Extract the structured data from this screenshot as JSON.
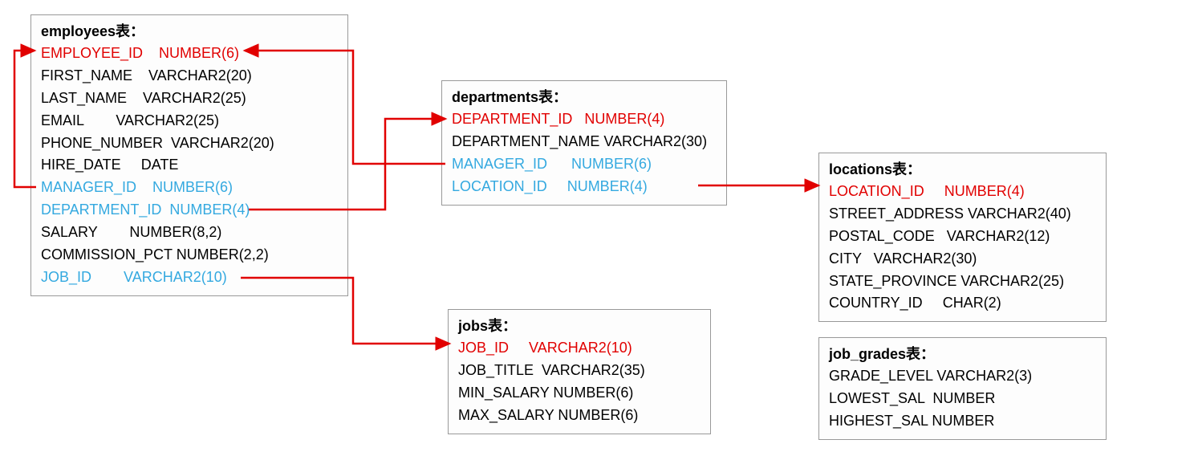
{
  "tables": {
    "employees": {
      "title": "employees表：",
      "cols": [
        {
          "n": "EMPLOYEE_ID",
          "t": "NUMBER(6)",
          "role": "pk",
          "pad": 4
        },
        {
          "n": "FIRST_NAME",
          "t": "VARCHAR2(20)",
          "role": "norm",
          "pad": 4
        },
        {
          "n": "LAST_NAME",
          "t": "VARCHAR2(25)",
          "role": "norm",
          "pad": 4
        },
        {
          "n": "EMAIL",
          "t": "VARCHAR2(25)",
          "role": "norm",
          "pad": 8
        },
        {
          "n": "PHONE_NUMBER",
          "t": "VARCHAR2(20)",
          "role": "norm",
          "pad": 2
        },
        {
          "n": "HIRE_DATE",
          "t": "DATE",
          "role": "norm",
          "pad": 5
        },
        {
          "n": "MANAGER_ID",
          "t": "NUMBER(6)",
          "role": "fk",
          "pad": 4
        },
        {
          "n": "DEPARTMENT_ID",
          "t": "NUMBER(4)",
          "role": "fk",
          "pad": 2
        },
        {
          "n": "SALARY",
          "t": "NUMBER(8,2)",
          "role": "norm",
          "pad": 8
        },
        {
          "n": "COMMISSION_PCT",
          "t": "NUMBER(2,2)",
          "role": "norm",
          "pad": 1
        },
        {
          "n": "JOB_ID",
          "t": "VARCHAR2(10)",
          "role": "fk",
          "pad": 8
        }
      ]
    },
    "departments": {
      "title": "departments表：",
      "cols": [
        {
          "n": "DEPARTMENT_ID",
          "t": "NUMBER(4)",
          "role": "pk",
          "pad": 3
        },
        {
          "n": "DEPARTMENT_NAME",
          "t": "VARCHAR2(30)",
          "role": "norm",
          "pad": 1
        },
        {
          "n": "MANAGER_ID",
          "t": "NUMBER(6)",
          "role": "fk",
          "pad": 6
        },
        {
          "n": "LOCATION_ID",
          "t": "NUMBER(4)",
          "role": "fk",
          "pad": 5
        }
      ]
    },
    "jobs": {
      "title": "jobs表：",
      "cols": [
        {
          "n": "JOB_ID",
          "t": "VARCHAR2(10)",
          "role": "pk",
          "pad": 5
        },
        {
          "n": "JOB_TITLE",
          "t": "VARCHAR2(35)",
          "role": "norm",
          "pad": 2
        },
        {
          "n": "MIN_SALARY",
          "t": "NUMBER(6)",
          "role": "norm",
          "pad": 1
        },
        {
          "n": "MAX_SALARY",
          "t": "NUMBER(6)",
          "role": "norm",
          "pad": 1
        }
      ]
    },
    "locations": {
      "title": "locations表：",
      "cols": [
        {
          "n": "LOCATION_ID",
          "t": "NUMBER(4)",
          "role": "pk",
          "pad": 5
        },
        {
          "n": "STREET_ADDRESS",
          "t": "VARCHAR2(40)",
          "role": "norm",
          "pad": 1
        },
        {
          "n": "POSTAL_CODE",
          "t": "VARCHAR2(12)",
          "role": "norm",
          "pad": 3
        },
        {
          "n": "CITY",
          "t": "VARCHAR2(30)",
          "role": "norm",
          "pad": 3
        },
        {
          "n": "STATE_PROVINCE",
          "t": "VARCHAR2(25)",
          "role": "norm",
          "pad": 1
        },
        {
          "n": "COUNTRY_ID",
          "t": "CHAR(2)",
          "role": "norm",
          "pad": 5
        }
      ]
    },
    "job_grades": {
      "title": "job_grades表：",
      "cols": [
        {
          "n": "GRADE_LEVEL",
          "t": "VARCHAR2(3)",
          "role": "norm",
          "pad": 1
        },
        {
          "n": "LOWEST_SAL",
          "t": "NUMBER",
          "role": "norm",
          "pad": 2
        },
        {
          "n": "HIGHEST_SAL",
          "t": "NUMBER",
          "role": "norm",
          "pad": 1
        }
      ]
    }
  },
  "chart_data": {
    "type": "table",
    "description": "Entity-relationship / schema diagram of HR sample schema in Chinese (表 = table). Red columns are primary keys, blue columns are foreign keys. Red arrows show FK -> PK references.",
    "entities": [
      {
        "name": "employees",
        "primary_key": [
          "EMPLOYEE_ID"
        ],
        "foreign_keys": [
          "MANAGER_ID",
          "DEPARTMENT_ID",
          "JOB_ID"
        ],
        "columns": [
          [
            "EMPLOYEE_ID",
            "NUMBER(6)"
          ],
          [
            "FIRST_NAME",
            "VARCHAR2(20)"
          ],
          [
            "LAST_NAME",
            "VARCHAR2(25)"
          ],
          [
            "EMAIL",
            "VARCHAR2(25)"
          ],
          [
            "PHONE_NUMBER",
            "VARCHAR2(20)"
          ],
          [
            "HIRE_DATE",
            "DATE"
          ],
          [
            "MANAGER_ID",
            "NUMBER(6)"
          ],
          [
            "DEPARTMENT_ID",
            "NUMBER(4)"
          ],
          [
            "SALARY",
            "NUMBER(8,2)"
          ],
          [
            "COMMISSION_PCT",
            "NUMBER(2,2)"
          ],
          [
            "JOB_ID",
            "VARCHAR2(10)"
          ]
        ]
      },
      {
        "name": "departments",
        "primary_key": [
          "DEPARTMENT_ID"
        ],
        "foreign_keys": [
          "MANAGER_ID",
          "LOCATION_ID"
        ],
        "columns": [
          [
            "DEPARTMENT_ID",
            "NUMBER(4)"
          ],
          [
            "DEPARTMENT_NAME",
            "VARCHAR2(30)"
          ],
          [
            "MANAGER_ID",
            "NUMBER(6)"
          ],
          [
            "LOCATION_ID",
            "NUMBER(4)"
          ]
        ]
      },
      {
        "name": "jobs",
        "primary_key": [
          "JOB_ID"
        ],
        "foreign_keys": [],
        "columns": [
          [
            "JOB_ID",
            "VARCHAR2(10)"
          ],
          [
            "JOB_TITLE",
            "VARCHAR2(35)"
          ],
          [
            "MIN_SALARY",
            "NUMBER(6)"
          ],
          [
            "MAX_SALARY",
            "NUMBER(6)"
          ]
        ]
      },
      {
        "name": "locations",
        "primary_key": [
          "LOCATION_ID"
        ],
        "foreign_keys": [],
        "columns": [
          [
            "LOCATION_ID",
            "NUMBER(4)"
          ],
          [
            "STREET_ADDRESS",
            "VARCHAR2(40)"
          ],
          [
            "POSTAL_CODE",
            "VARCHAR2(12)"
          ],
          [
            "CITY",
            "VARCHAR2(30)"
          ],
          [
            "STATE_PROVINCE",
            "VARCHAR2(25)"
          ],
          [
            "COUNTRY_ID",
            "CHAR(2)"
          ]
        ]
      },
      {
        "name": "job_grades",
        "primary_key": [],
        "foreign_keys": [],
        "columns": [
          [
            "GRADE_LEVEL",
            "VARCHAR2(3)"
          ],
          [
            "LOWEST_SAL",
            "NUMBER"
          ],
          [
            "HIGHEST_SAL",
            "NUMBER"
          ]
        ]
      }
    ],
    "relationships": [
      {
        "from_table": "employees",
        "from_column": "MANAGER_ID",
        "to_table": "employees",
        "to_column": "EMPLOYEE_ID"
      },
      {
        "from_table": "employees",
        "from_column": "DEPARTMENT_ID",
        "to_table": "departments",
        "to_column": "DEPARTMENT_ID"
      },
      {
        "from_table": "employees",
        "from_column": "JOB_ID",
        "to_table": "jobs",
        "to_column": "JOB_ID"
      },
      {
        "from_table": "departments",
        "from_column": "MANAGER_ID",
        "to_table": "employees",
        "to_column": "EMPLOYEE_ID"
      },
      {
        "from_table": "departments",
        "from_column": "LOCATION_ID",
        "to_table": "locations",
        "to_column": "LOCATION_ID"
      }
    ]
  }
}
